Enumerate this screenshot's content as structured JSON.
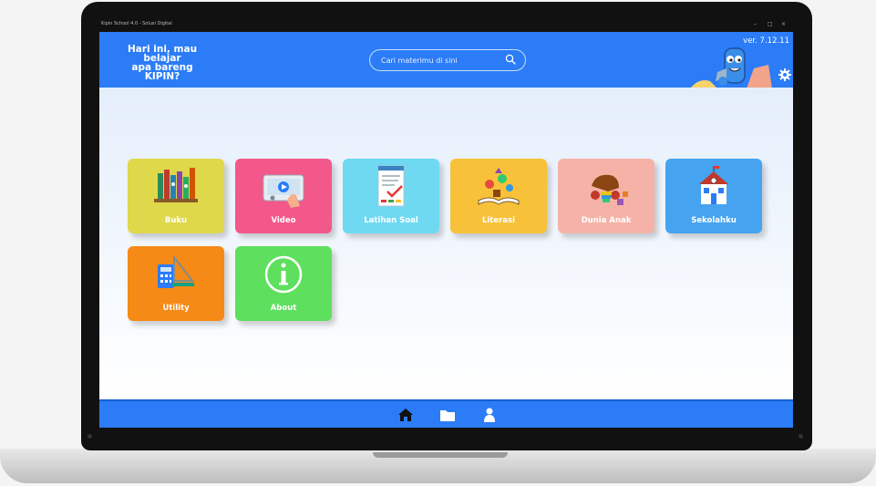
{
  "window": {
    "title": "Kipin School 4.0 - Solusi Digital",
    "controls": [
      "–",
      "□",
      "×"
    ]
  },
  "header": {
    "tagline_lines": [
      "Hari ini, mau belajar",
      "apa bareng",
      "KIPIN?"
    ],
    "search_placeholder": "Cari materimu di sini",
    "version": "ver. 7.12.11",
    "search_icon": "search-icon",
    "settings_icon": "gear-icon"
  },
  "menu": {
    "tiles": [
      {
        "label": "Buku",
        "color": "#dfd84a",
        "icon": "books-icon"
      },
      {
        "label": "Video",
        "color": "#f2588a",
        "icon": "video-player-icon"
      },
      {
        "label": "Latihan Soal",
        "color": "#6fd9f2",
        "icon": "quiz-document-icon"
      },
      {
        "label": "Literasi",
        "color": "#f7c23a",
        "icon": "open-book-icon"
      },
      {
        "label": "Dunia Anak",
        "color": "#f5b3a8",
        "icon": "toys-icon"
      },
      {
        "label": "Sekolahku",
        "color": "#46a3ef",
        "icon": "school-building-icon"
      },
      {
        "label": "Utility",
        "color": "#f58a16",
        "icon": "calculator-tools-icon"
      },
      {
        "label": "About",
        "color": "#5ee05e",
        "icon": "info-icon"
      }
    ]
  },
  "bottom_nav": {
    "items": [
      "home-icon",
      "folder-icon",
      "user-icon"
    ]
  },
  "colors": {
    "brand_blue": "#2b7cf6",
    "background": "#e4eefb"
  }
}
